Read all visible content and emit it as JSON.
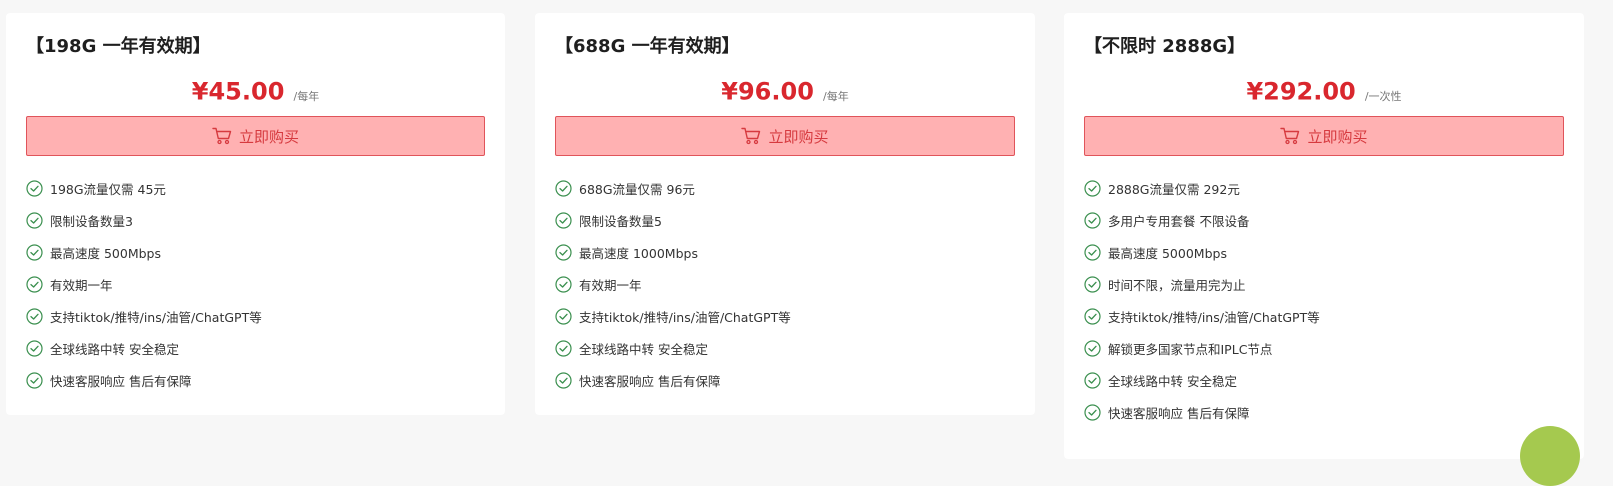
{
  "accent_color": "#d9272e",
  "button_bg_color": "#ffb1b2",
  "check_color": "#3a8f4e",
  "plans": [
    {
      "title": "【198G 一年有效期】",
      "price": "¥45.00",
      "period": "/每年",
      "buy_label": "立即购买",
      "features": [
        "198G流量仅需 45元",
        "限制设备数量3",
        "最高速度 500Mbps",
        "有效期一年",
        "支持tiktok/推特/ins/油管/ChatGPT等",
        "全球线路中转 安全稳定",
        "快速客服响应 售后有保障"
      ]
    },
    {
      "title": "【688G 一年有效期】",
      "price": "¥96.00",
      "period": "/每年",
      "buy_label": "立即购买",
      "features": [
        "688G流量仅需 96元",
        "限制设备数量5",
        "最高速度 1000Mbps",
        "有效期一年",
        "支持tiktok/推特/ins/油管/ChatGPT等",
        "全球线路中转 安全稳定",
        "快速客服响应 售后有保障"
      ]
    },
    {
      "title": "【不限时 2888G】",
      "price": "¥292.00",
      "period": "/一次性",
      "buy_label": "立即购买",
      "features": [
        "2888G流量仅需 292元",
        "多用户专用套餐 不限设备",
        "最高速度 5000Mbps",
        "时间不限，流量用完为止",
        "支持tiktok/推特/ins/油管/ChatGPT等",
        "解锁更多国家节点和IPLC节点",
        "全球线路中转 安全稳定",
        "快速客服响应 售后有保障"
      ]
    }
  ],
  "icons": {
    "buy": "cart-icon",
    "feature": "check-circle-icon"
  }
}
